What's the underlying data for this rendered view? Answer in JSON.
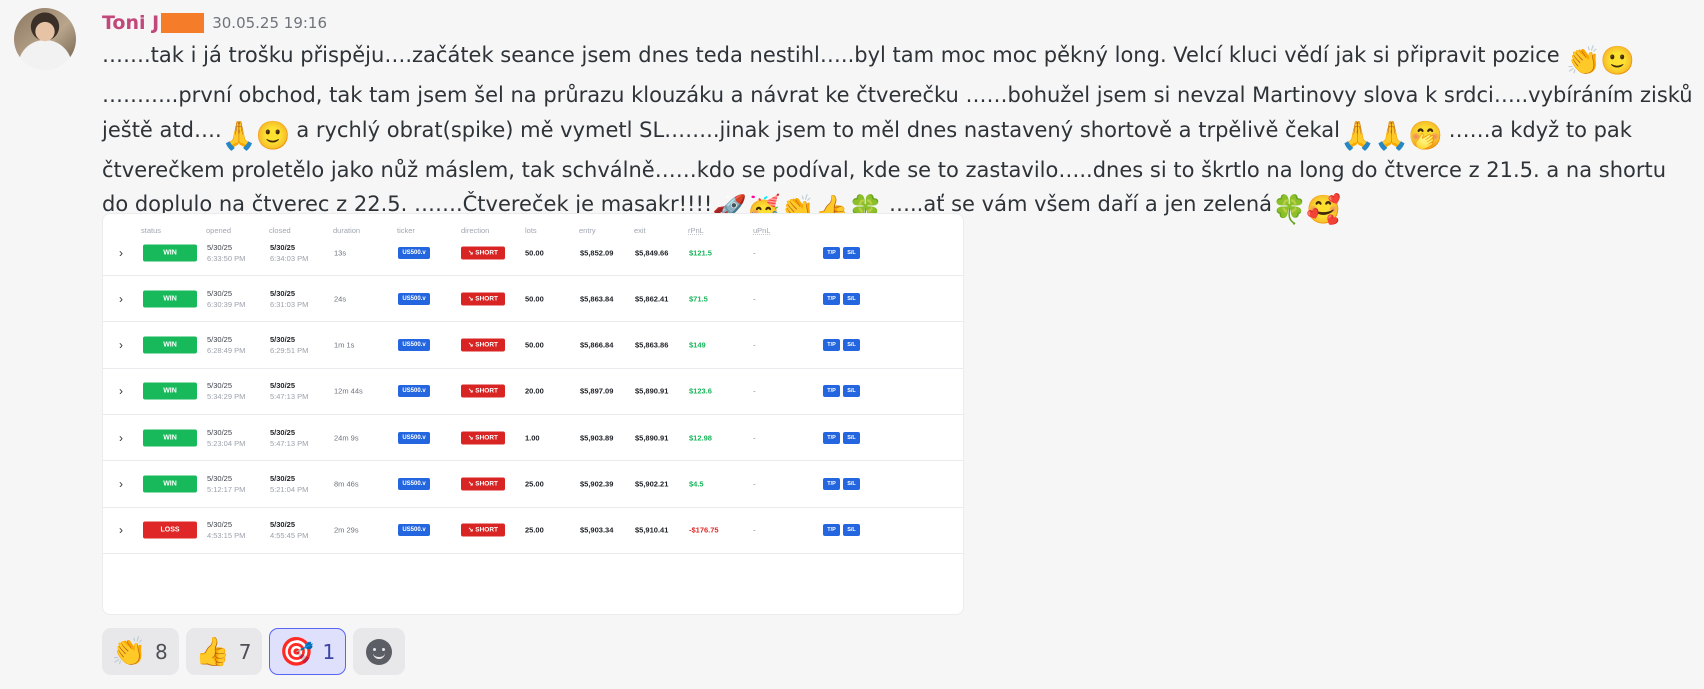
{
  "message": {
    "author": "Toni J",
    "timestamp": "30.05.25 19:16",
    "segments": [
      {
        "t": "…….tak i já trošku přispěju….začátek seance jsem dnes teda nestihl…..byl tam moc moc pěkný long. Velcí kluci vědí jak si připravit pozice "
      },
      {
        "e": "👏",
        "name": "clapping-hands-icon"
      },
      {
        "e": "🙂",
        "name": "slight-smile-icon"
      },
      {
        "t": " ………..první obchod, tak tam jsem šel na průrazu klouzáku a návrat ke čtverečku ……bohužel jsem si nevzal Martinovy slova k srdci…..vybíráním zisků ještě atd…."
      },
      {
        "e": "🙏",
        "name": "folded-hands-icon"
      },
      {
        "e": "🙂",
        "name": "slight-smile-icon"
      },
      {
        "t": " a rychlý obrat(spike) mě vymetl SL……..jinak jsem to měl dnes nastavený shortově a trpělivě čekal"
      },
      {
        "e": "🙏",
        "name": "folded-hands-icon"
      },
      {
        "e": "🙏",
        "name": "folded-hands-icon"
      },
      {
        "e": "🤭",
        "name": "face-hand-mouth-icon"
      },
      {
        "t": " ……a když to pak čtverečkem proletělo jako nůž máslem, tak schválně……kdo se podíval, kde se to zastavilo…..dnes si to škrtlo na long do čtverce z 21.5. a na shortu do doplulo na čtverec z 22.5. …….Čtvereček je masakr!!!!"
      },
      {
        "e": "🚀",
        "name": "rocket-icon"
      },
      {
        "e": "🥳",
        "name": "party-face-icon"
      },
      {
        "e": "👏",
        "name": "clapping-hands-icon"
      },
      {
        "e": "👍",
        "name": "thumbs-up-icon"
      },
      {
        "e": "🍀",
        "name": "four-leaf-clover-icon"
      },
      {
        "t": " …..ať se vám všem daří a jen zelená"
      },
      {
        "e": "🍀",
        "name": "four-leaf-clover-icon"
      },
      {
        "e": "🥰",
        "name": "smiling-hearts-icon"
      }
    ]
  },
  "trades": {
    "columns": [
      "status",
      "opened",
      "closed",
      "duration",
      "ticker",
      "direction",
      "lots",
      "entry",
      "exit",
      "rPnL",
      "uPnL"
    ],
    "rows": [
      {
        "status": "WIN",
        "opened_date": "5/30/25",
        "opened_time": "6:33:50 PM",
        "closed_date": "5/30/25",
        "closed_time": "6:34:03 PM",
        "duration": "13s",
        "ticker": "US500.v",
        "direction": "SHORT",
        "lots": "50.00",
        "entry": "$5,852.09",
        "exit": "$5,849.66",
        "rpnl": "$121.5",
        "upnl": "-",
        "tp": "T/P",
        "sl": "S/L"
      },
      {
        "status": "WIN",
        "opened_date": "5/30/25",
        "opened_time": "6:30:39 PM",
        "closed_date": "5/30/25",
        "closed_time": "6:31:03 PM",
        "duration": "24s",
        "ticker": "US500.v",
        "direction": "SHORT",
        "lots": "50.00",
        "entry": "$5,863.84",
        "exit": "$5,862.41",
        "rpnl": "$71.5",
        "upnl": "-",
        "tp": "T/P",
        "sl": "S/L"
      },
      {
        "status": "WIN",
        "opened_date": "5/30/25",
        "opened_time": "6:28:49 PM",
        "closed_date": "5/30/25",
        "closed_time": "6:29:51 PM",
        "duration": "1m 1s",
        "ticker": "US500.v",
        "direction": "SHORT",
        "lots": "50.00",
        "entry": "$5,866.84",
        "exit": "$5,863.86",
        "rpnl": "$149",
        "upnl": "-",
        "tp": "T/P",
        "sl": "S/L"
      },
      {
        "status": "WIN",
        "opened_date": "5/30/25",
        "opened_time": "5:34:29 PM",
        "closed_date": "5/30/25",
        "closed_time": "5:47:13 PM",
        "duration": "12m 44s",
        "ticker": "US500.v",
        "direction": "SHORT",
        "lots": "20.00",
        "entry": "$5,897.09",
        "exit": "$5,890.91",
        "rpnl": "$123.6",
        "upnl": "-",
        "tp": "T/P",
        "sl": "S/L"
      },
      {
        "status": "WIN",
        "opened_date": "5/30/25",
        "opened_time": "5:23:04 PM",
        "closed_date": "5/30/25",
        "closed_time": "5:47:13 PM",
        "duration": "24m 9s",
        "ticker": "US500.v",
        "direction": "SHORT",
        "lots": "1.00",
        "entry": "$5,903.89",
        "exit": "$5,890.91",
        "rpnl": "$12.98",
        "upnl": "-",
        "tp": "T/P",
        "sl": "S/L"
      },
      {
        "status": "WIN",
        "opened_date": "5/30/25",
        "opened_time": "5:12:17 PM",
        "closed_date": "5/30/25",
        "closed_time": "5:21:04 PM",
        "duration": "8m 46s",
        "ticker": "US500.v",
        "direction": "SHORT",
        "lots": "25.00",
        "entry": "$5,902.39",
        "exit": "$5,902.21",
        "rpnl": "$4.5",
        "upnl": "-",
        "tp": "T/P",
        "sl": "S/L"
      },
      {
        "status": "LOSS",
        "opened_date": "5/30/25",
        "opened_time": "4:53:15 PM",
        "closed_date": "5/30/25",
        "closed_time": "4:55:45 PM",
        "duration": "2m 29s",
        "ticker": "US500.v",
        "direction": "SHORT",
        "lots": "25.00",
        "entry": "$5,903.34",
        "exit": "$5,910.41",
        "rpnl": "-$176.75",
        "upnl": "-",
        "tp": "T/P",
        "sl": "S/L"
      }
    ]
  },
  "reactions": [
    {
      "emoji": "👏",
      "icon": "clapping-hands-icon",
      "count": "8",
      "active": false
    },
    {
      "emoji": "👍",
      "icon": "thumbs-up-icon",
      "count": "7",
      "active": false
    },
    {
      "emoji": "🎯",
      "icon": "direct-hit-icon",
      "count": "1",
      "active": true
    }
  ]
}
